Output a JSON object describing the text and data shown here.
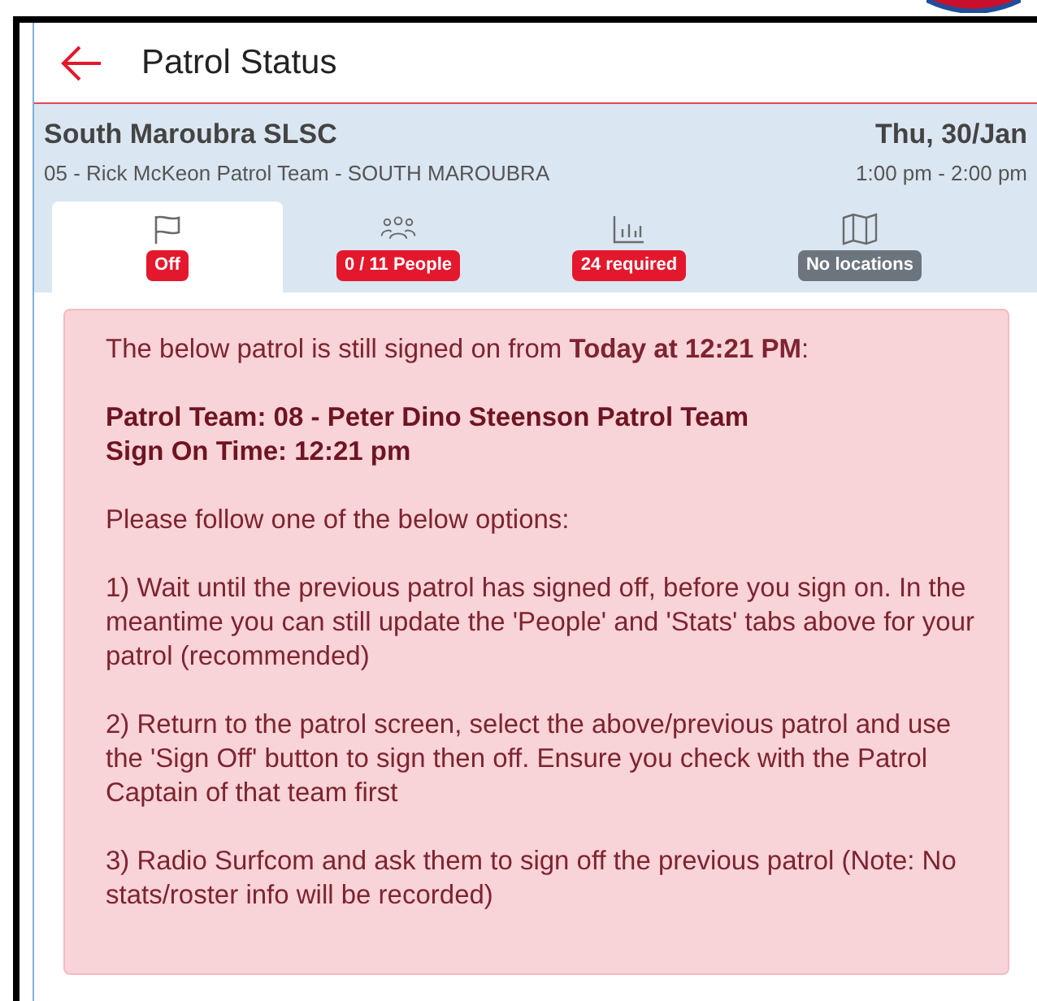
{
  "header": {
    "title": "Patrol Status"
  },
  "info": {
    "club": "South Maroubra SLSC",
    "date": "Thu, 30/Jan",
    "team": "05 - Rick McKeon Patrol Team - SOUTH MAROUBRA",
    "time": "1:00 pm - 2:00 pm"
  },
  "tabs": [
    {
      "kind": "flag",
      "badge": "Off",
      "color": "#e3182d",
      "selected": true
    },
    {
      "kind": "people",
      "badge": "0 / 11 People",
      "color": "#e3182d",
      "selected": false
    },
    {
      "kind": "stats",
      "badge": "24 required",
      "color": "#e3182d",
      "selected": false
    },
    {
      "kind": "map",
      "badge": "No locations",
      "color": "#6c757d",
      "selected": false
    }
  ],
  "alert": {
    "intro": "The below patrol is still signed on from **Today at 12:21 PM**:",
    "patrol_team": "Patrol Team: 08 - Peter Dino Steenson Patrol Team",
    "sign_on_time": "Sign On Time: 12:21 pm",
    "instruction": "Please follow one of the below options:",
    "options": [
      "1) Wait until the previous patrol has signed off, before you sign on. In the meantime you can still update the 'People' and 'Stats' tabs above for your patrol (recommended)",
      "2) Return to the patrol screen, select the above/previous patrol and use the 'Sign Off' button to sign then off. Ensure you check with the Patrol Captain of that team first",
      "3) Radio Surfcom and ask them to sign off the previous patrol (Note: No stats/roster info will be recorded)"
    ]
  }
}
